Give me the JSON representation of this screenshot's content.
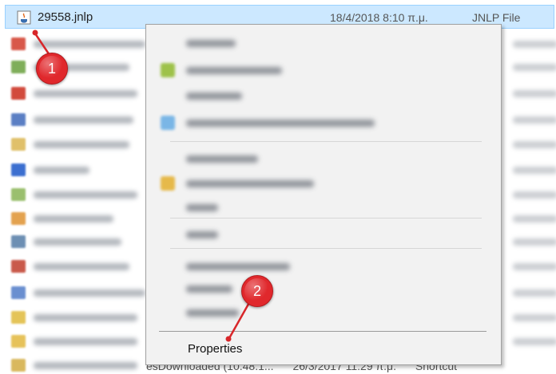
{
  "selected_file": {
    "name": "29558.jnlp",
    "date": "18/4/2018 8:10 π.μ.",
    "type": "JNLP File"
  },
  "context_menu": {
    "last_item_label": "Properties"
  },
  "background_fragment": {
    "name_fragment": "esDownloaded (10.48.1...",
    "date_fragment": "26/3/2017 11:29 π.μ.",
    "type_fragment": "Shortcut"
  },
  "callouts": [
    "1",
    "2"
  ],
  "colors": {
    "selection_bg": "#cce8ff",
    "menu_bg": "#f2f2f2",
    "callout_red": "#e0282c"
  },
  "icons": {
    "file_icon": "java-jnlp-icon",
    "pointer": "callout-pointer-line"
  }
}
